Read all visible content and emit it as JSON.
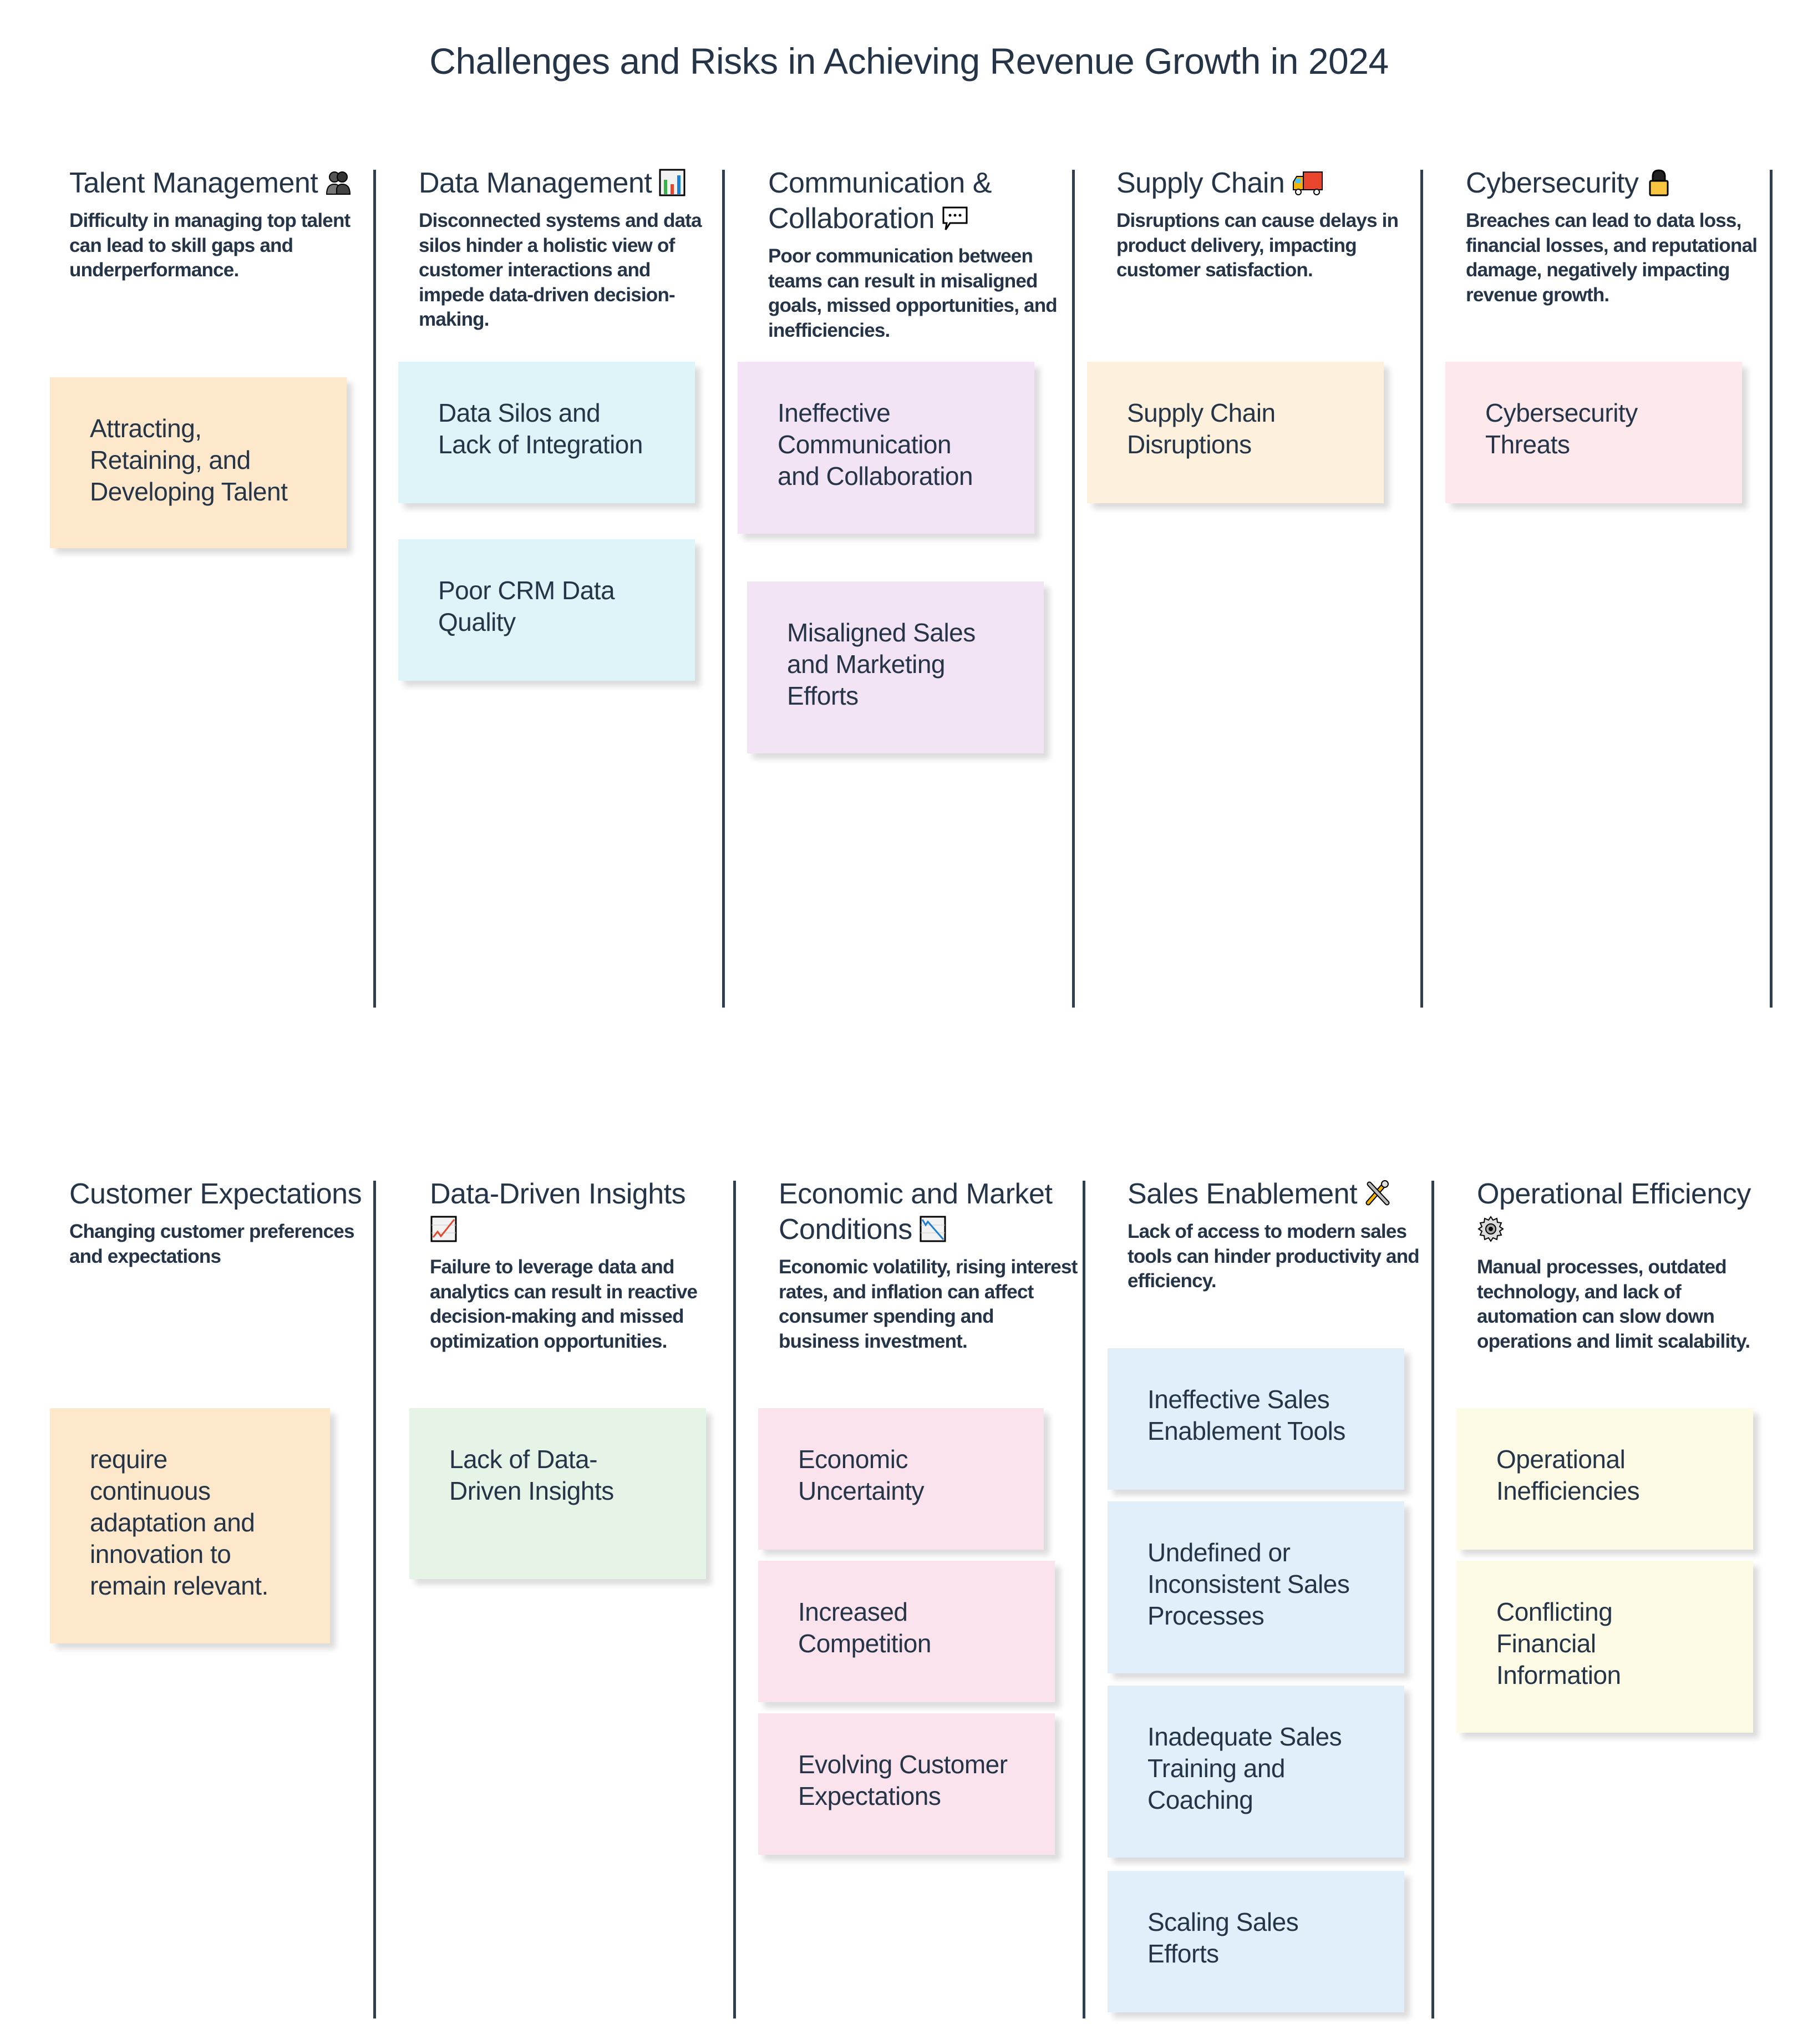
{
  "title": "Challenges and Risks in Achieving Revenue Growth in 2024",
  "rows": [
    {
      "columns": [
        {
          "title": "Talent Management",
          "icon": "people-icon",
          "description": "Difficulty in managing top talent can lead to skill gaps and underperformance.",
          "color": "#fde8cb",
          "notes": [
            "Attracting, Retaining, and Developing Talent"
          ]
        },
        {
          "title": "Data Management",
          "icon": "bar-chart-icon",
          "description": "Disconnected systems and data silos hinder a holistic view of customer interactions and impede data-driven decision-making.",
          "color": "#dff4f8",
          "notes": [
            "Data Silos and Lack of Integration",
            "Poor CRM Data Quality"
          ]
        },
        {
          "title": "Communication & Collaboration",
          "icon": "speech-bubble-icon",
          "description": "Poor communication between teams can result in misaligned goals, missed opportunities, and inefficiencies.",
          "color": "#f2e4f4",
          "notes": [
            "Ineffective Communication and Collaboration",
            "Misaligned Sales and Marketing Efforts"
          ]
        },
        {
          "title": "Supply Chain",
          "icon": "truck-icon",
          "description": "Disruptions can cause delays in product delivery, impacting customer satisfaction.",
          "color": "#fdf0dd",
          "notes": [
            "Supply Chain Disruptions"
          ]
        },
        {
          "title": "Cybersecurity",
          "icon": "lock-icon",
          "description": "Breaches can lead to data loss, financial losses, and reputational damage, negatively impacting revenue growth.",
          "color": "#fde8ec",
          "notes": [
            "Cybersecurity Threats"
          ]
        }
      ]
    },
    {
      "columns": [
        {
          "title": "Customer Expectations",
          "icon": "",
          "description": "Changing customer preferences and expectations",
          "color": "#fde8cb",
          "notes": [
            "require continuous adaptation and innovation to remain relevant."
          ]
        },
        {
          "title": "Data-Driven Insights",
          "icon": "chart-increasing-icon",
          "description": "Failure to leverage data and analytics can result in reactive decision-making and missed optimization opportunities.",
          "color": "#e6f4e8",
          "notes": [
            "Lack of Data-Driven Insights"
          ]
        },
        {
          "title": "Economic and Market Conditions",
          "icon": "chart-decreasing-icon",
          "description": "Economic volatility, rising interest rates, and inflation can affect consumer spending and business investment.",
          "color": "#fae3ec",
          "notes": [
            "Economic Uncertainty",
            "Increased Competition",
            "Evolving Customer Expectations"
          ]
        },
        {
          "title": "Sales Enablement",
          "icon": "tools-icon",
          "description": "Lack of access to modern sales tools can hinder productivity and efficiency.",
          "color": "#e1effb",
          "notes": [
            "Ineffective Sales Enablement Tools",
            "Undefined or Inconsistent Sales Processes",
            "Inadequate Sales Training and Coaching",
            "Scaling Sales Efforts"
          ]
        },
        {
          "title": "Operational Efficiency",
          "icon": "gear-icon",
          "description": "Manual processes, outdated technology, and lack of automation can slow down operations and limit scalability.",
          "color": "#fdfbe6",
          "notes": [
            "Operational Inefficiencies",
            "Conflicting Financial Information"
          ]
        }
      ]
    }
  ]
}
